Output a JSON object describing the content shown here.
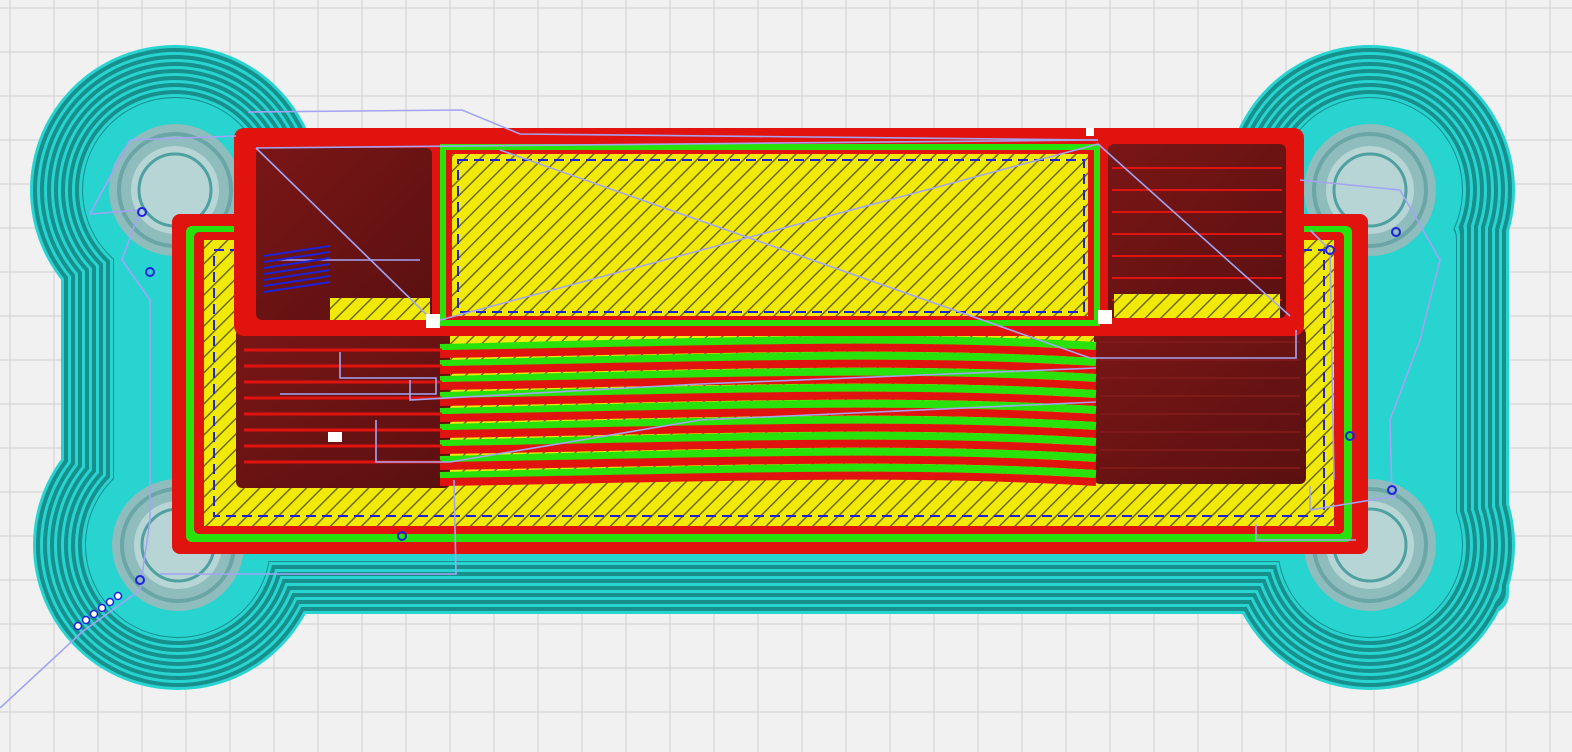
{
  "app": {
    "view": "layer-view"
  },
  "colors": {
    "build_plate": "#f1f1f1",
    "grid_line": "#cfcfcf",
    "skirt_brim": "#27d4d0",
    "skirt_brim_dark": "#178f8d",
    "brim_shadow": "#8fbcbc",
    "wall_outer": "#e0130f",
    "wall_shadow": "#6b1414",
    "skin": "#f1ea08",
    "infill_hatch": "#6f6a0a",
    "wall_inner": "#29e20c",
    "travel": "#a4a4f4",
    "retraction": "#1d22d9"
  },
  "legend": {
    "features": [
      "skirt-brim",
      "outer-wall",
      "inner-wall",
      "top-bottom-skin",
      "travel-moves",
      "retractions"
    ]
  }
}
